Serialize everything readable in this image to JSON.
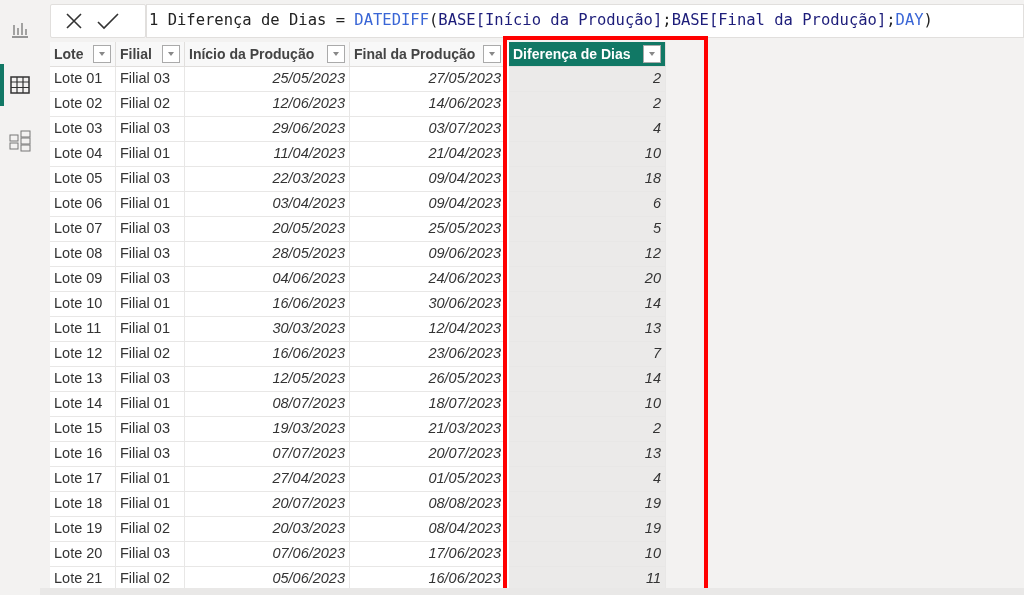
{
  "sidebar": {
    "items": [
      {
        "kind": "report",
        "selected": false
      },
      {
        "kind": "data",
        "selected": true
      },
      {
        "kind": "model",
        "selected": false
      }
    ]
  },
  "formula_bar": {
    "tokens": [
      {
        "kind": "plain",
        "text": "1 Diferença de Dias = "
      },
      {
        "kind": "function",
        "text": "DATEDIFF"
      },
      {
        "kind": "plain",
        "text": "("
      },
      {
        "kind": "column",
        "text": "BASE[Início da Produção]"
      },
      {
        "kind": "plain",
        "text": ";"
      },
      {
        "kind": "column",
        "text": "BASE[Final da Produção]"
      },
      {
        "kind": "plain",
        "text": ";"
      },
      {
        "kind": "function",
        "text": "DAY"
      },
      {
        "kind": "plain",
        "text": ")"
      }
    ]
  },
  "table": {
    "columns": [
      {
        "label": "Lote",
        "kind": "text",
        "selected": false,
        "highlighted": false
      },
      {
        "label": "Filial",
        "kind": "text",
        "selected": false,
        "highlighted": false
      },
      {
        "label": "Início da Produção",
        "kind": "date",
        "selected": false,
        "highlighted": false
      },
      {
        "label": "Final da Produção",
        "kind": "date",
        "selected": false,
        "highlighted": false
      },
      {
        "label": "Diferença de Dias",
        "kind": "number",
        "selected": true,
        "highlighted": true
      }
    ],
    "rows": [
      [
        "Lote 01",
        "Filial 03",
        "25/05/2023",
        "27/05/2023",
        "2"
      ],
      [
        "Lote 02",
        "Filial 02",
        "12/06/2023",
        "14/06/2023",
        "2"
      ],
      [
        "Lote 03",
        "Filial 03",
        "29/06/2023",
        "03/07/2023",
        "4"
      ],
      [
        "Lote 04",
        "Filial 01",
        "11/04/2023",
        "21/04/2023",
        "10"
      ],
      [
        "Lote 05",
        "Filial 03",
        "22/03/2023",
        "09/04/2023",
        "18"
      ],
      [
        "Lote 06",
        "Filial 01",
        "03/04/2023",
        "09/04/2023",
        "6"
      ],
      [
        "Lote 07",
        "Filial 03",
        "20/05/2023",
        "25/05/2023",
        "5"
      ],
      [
        "Lote 08",
        "Filial 03",
        "28/05/2023",
        "09/06/2023",
        "12"
      ],
      [
        "Lote 09",
        "Filial 03",
        "04/06/2023",
        "24/06/2023",
        "20"
      ],
      [
        "Lote 10",
        "Filial 01",
        "16/06/2023",
        "30/06/2023",
        "14"
      ],
      [
        "Lote 11",
        "Filial 01",
        "30/03/2023",
        "12/04/2023",
        "13"
      ],
      [
        "Lote 12",
        "Filial 02",
        "16/06/2023",
        "23/06/2023",
        "7"
      ],
      [
        "Lote 13",
        "Filial 03",
        "12/05/2023",
        "26/05/2023",
        "14"
      ],
      [
        "Lote 14",
        "Filial 01",
        "08/07/2023",
        "18/07/2023",
        "10"
      ],
      [
        "Lote 15",
        "Filial 03",
        "19/03/2023",
        "21/03/2023",
        "2"
      ],
      [
        "Lote 16",
        "Filial 03",
        "07/07/2023",
        "20/07/2023",
        "13"
      ],
      [
        "Lote 17",
        "Filial 01",
        "27/04/2023",
        "01/05/2023",
        "4"
      ],
      [
        "Lote 18",
        "Filial 01",
        "20/07/2023",
        "08/08/2023",
        "19"
      ],
      [
        "Lote 19",
        "Filial 02",
        "20/03/2023",
        "08/04/2023",
        "19"
      ],
      [
        "Lote 20",
        "Filial 03",
        "07/06/2023",
        "17/06/2023",
        "10"
      ],
      [
        "Lote 21",
        "Filial 02",
        "05/06/2023",
        "16/06/2023",
        "11"
      ]
    ]
  }
}
